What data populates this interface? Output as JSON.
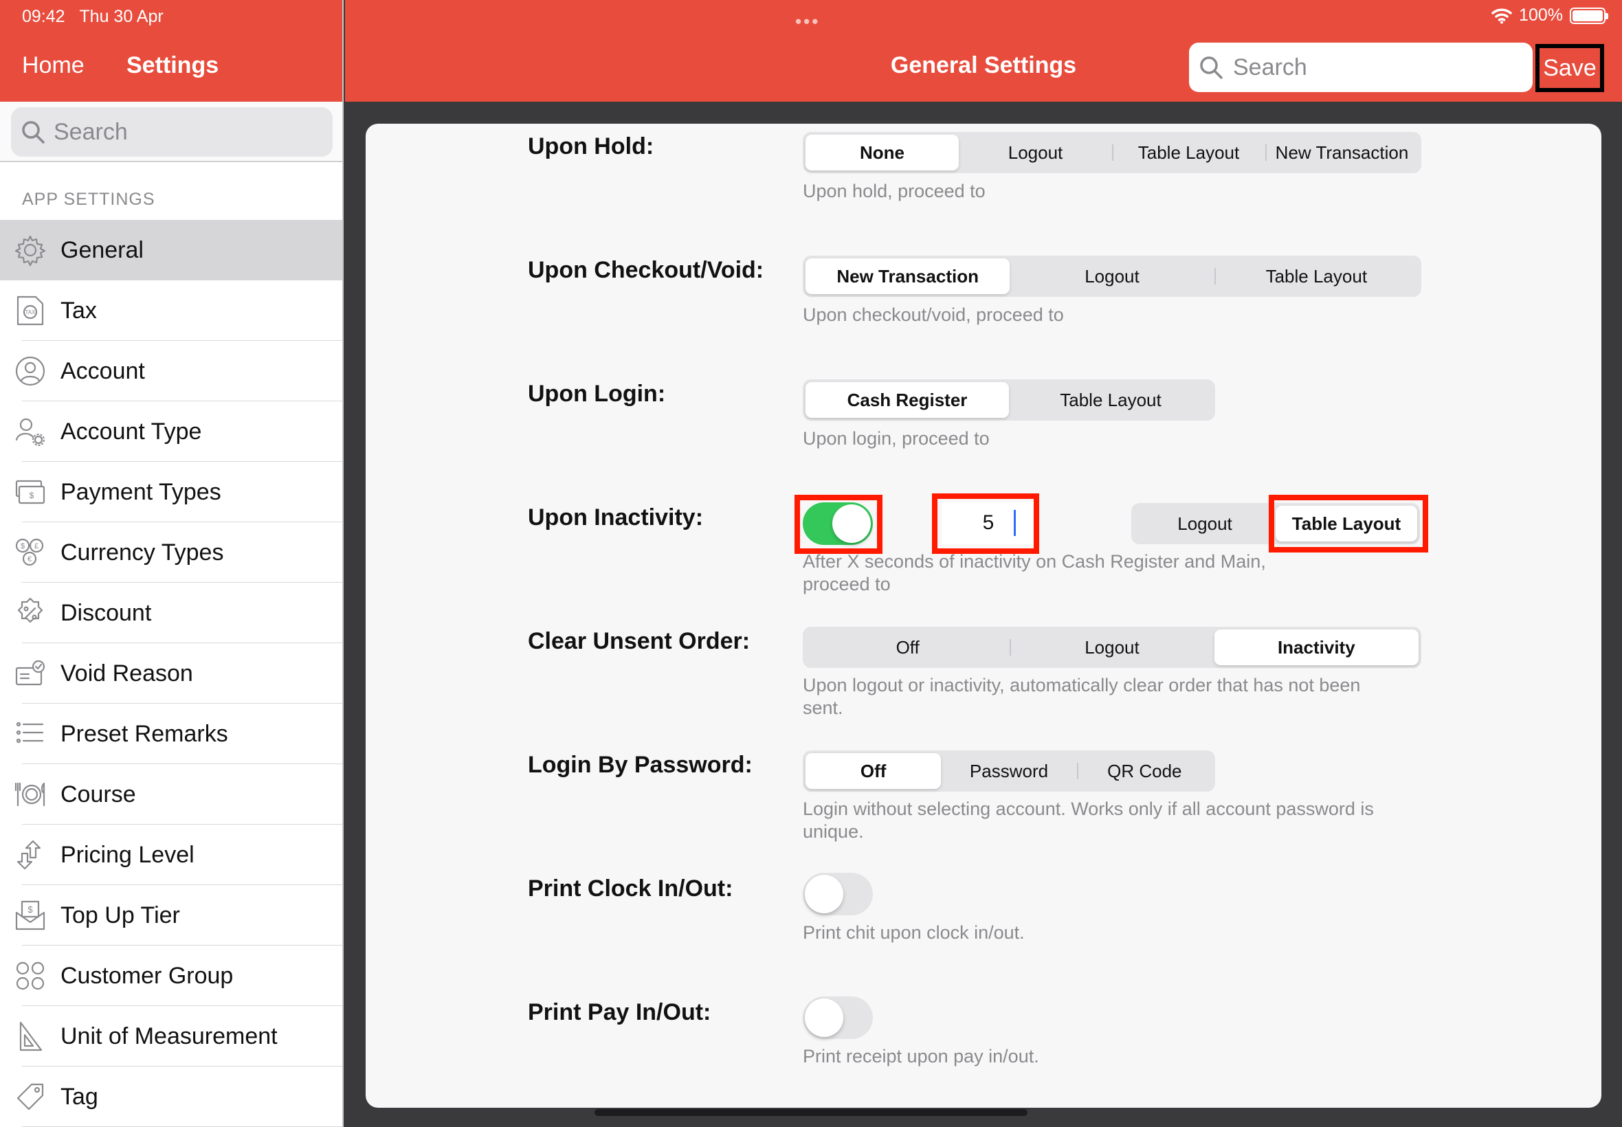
{
  "status_bar": {
    "time": "09:42",
    "date": "Thu 30 Apr",
    "battery": "100%",
    "dots": "•••"
  },
  "sidebar": {
    "nav_home": "Home",
    "nav_title": "Settings",
    "search_placeholder": "Search",
    "section_label": "APP SETTINGS",
    "items": [
      {
        "label": "General",
        "icon": "gear-icon",
        "active": true
      },
      {
        "label": "Tax",
        "icon": "tax-document-icon"
      },
      {
        "label": "Account",
        "icon": "user-icon"
      },
      {
        "label": "Account Type",
        "icon": "user-gear-icon"
      },
      {
        "label": "Payment Types",
        "icon": "cash-icon"
      },
      {
        "label": "Currency Types",
        "icon": "currency-icon"
      },
      {
        "label": "Discount",
        "icon": "percent-badge-icon"
      },
      {
        "label": "Void Reason",
        "icon": "void-reason-icon"
      },
      {
        "label": "Preset Remarks",
        "icon": "list-icon"
      },
      {
        "label": "Course",
        "icon": "dining-icon"
      },
      {
        "label": "Pricing Level",
        "icon": "pricing-arrows-icon"
      },
      {
        "label": "Top Up Tier",
        "icon": "top-up-envelope-icon"
      },
      {
        "label": "Customer Group",
        "icon": "customer-group-icon"
      },
      {
        "label": "Unit of Measurement",
        "icon": "set-square-icon"
      },
      {
        "label": "Tag",
        "icon": "tag-icon"
      }
    ]
  },
  "header": {
    "title": "General Settings",
    "search_placeholder": "Search",
    "save_label": "Save",
    "accent": "#e84c3d"
  },
  "settings": {
    "upon_hold": {
      "label": "Upon Hold:",
      "options": [
        "None",
        "Logout",
        "Table Layout",
        "New Transaction"
      ],
      "selected": "None",
      "description": "Upon hold, proceed to"
    },
    "upon_checkout": {
      "label": "Upon Checkout/Void:",
      "options": [
        "New Transaction",
        "Logout",
        "Table Layout"
      ],
      "selected": "New Transaction",
      "description": "Upon checkout/void, proceed to"
    },
    "upon_login": {
      "label": "Upon Login:",
      "options": [
        "Cash Register",
        "Table Layout"
      ],
      "selected": "Cash Register",
      "description": "Upon login, proceed to"
    },
    "upon_inactivity": {
      "label": "Upon Inactivity:",
      "enabled": true,
      "seconds": "5",
      "options": [
        "Logout",
        "Table Layout"
      ],
      "selected": "Table Layout",
      "description": "After X seconds of inactivity on Cash Register and Main, proceed to"
    },
    "clear_unsent": {
      "label": "Clear Unsent Order:",
      "options": [
        "Off",
        "Logout",
        "Inactivity"
      ],
      "selected": "Inactivity",
      "description": "Upon logout or inactivity, automatically clear order that has not been sent."
    },
    "login_by_password": {
      "label": "Login By Password:",
      "options": [
        "Off",
        "Password",
        "QR Code"
      ],
      "selected": "Off",
      "description": "Login without selecting account. Works only if all account password is unique."
    },
    "print_clock": {
      "label": "Print Clock In/Out:",
      "enabled": false,
      "description": "Print chit upon clock in/out."
    },
    "print_pay": {
      "label": "Print Pay In/Out:",
      "enabled": false,
      "description": "Print receipt upon pay in/out."
    }
  },
  "colors": {
    "toggle_on": "#34c759",
    "highlight": "#ff1a00",
    "header": "#e84c3d"
  }
}
